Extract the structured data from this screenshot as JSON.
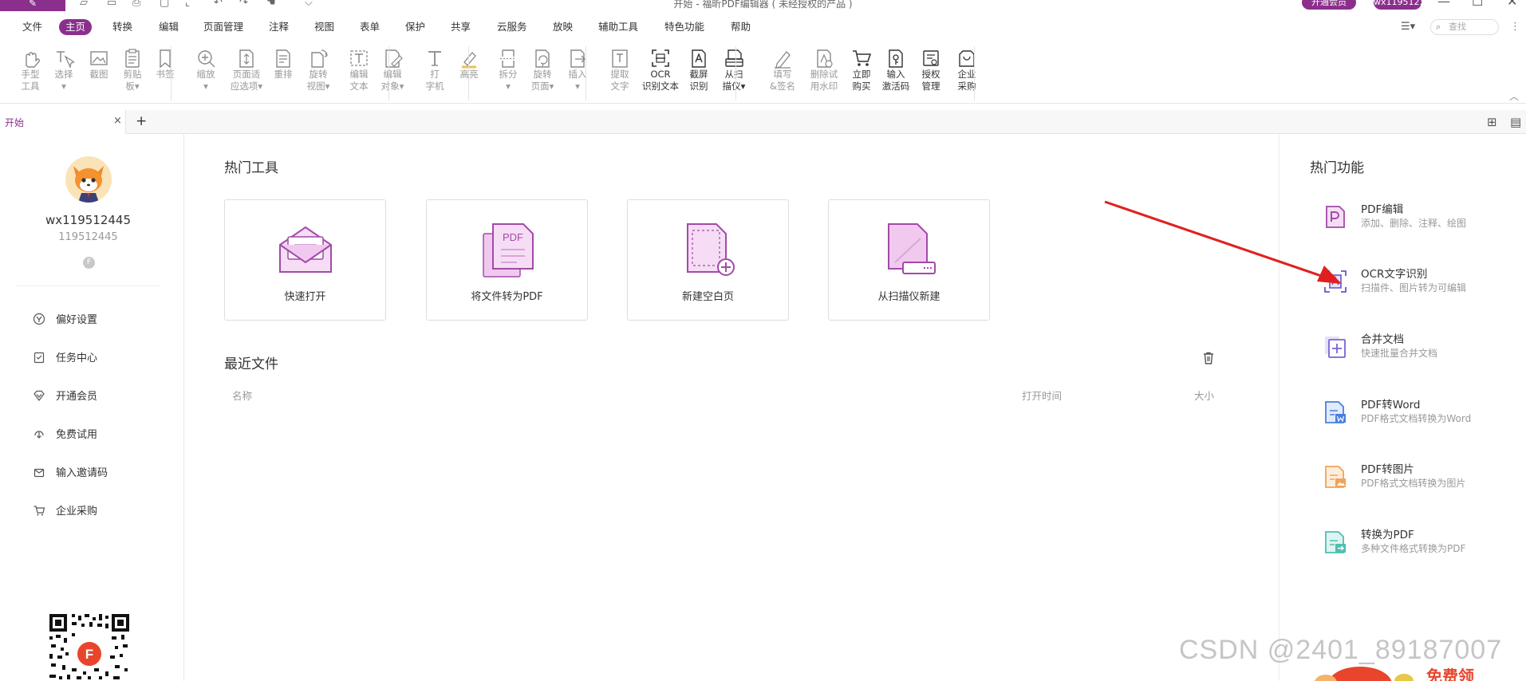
{
  "titlebar": {
    "title": "开始 - 福昕PDF编辑器 ( 未经授权的产品 )",
    "vip_button": "开通会员",
    "user": "wx119512...",
    "minimize": "—",
    "maximize": "☐",
    "close": "✕"
  },
  "menu": {
    "items": [
      "文件",
      "主页",
      "转换",
      "编辑",
      "页面管理",
      "注释",
      "视图",
      "表单",
      "保护",
      "共享",
      "云服务",
      "放映",
      "辅助工具",
      "特色功能",
      "帮助"
    ],
    "active_index": 1,
    "search_placeholder": "查找"
  },
  "ribbon": {
    "tools": [
      {
        "label": "手型\n工具",
        "icon": "hand-icon",
        "disabled": true
      },
      {
        "label": "选择\n▾",
        "icon": "select-text-icon",
        "disabled": true
      },
      {
        "label": "截图",
        "icon": "snapshot-icon",
        "disabled": true
      },
      {
        "label": "剪贴\n板▾",
        "icon": "clipboard-icon",
        "disabled": true
      },
      {
        "label": "书签",
        "icon": "bookmark-icon",
        "disabled": true
      },
      {
        "label": "缩放\n▾",
        "icon": "zoom-icon",
        "disabled": true
      },
      {
        "label": "页面适\n应选项▾",
        "icon": "fit-page-icon",
        "disabled": true
      },
      {
        "label": "重排",
        "icon": "reflow-icon",
        "disabled": true
      },
      {
        "label": "旋转\n视图▾",
        "icon": "rotate-view-icon",
        "disabled": true
      },
      {
        "label": "编辑\n文本",
        "icon": "edit-text-icon",
        "disabled": true
      },
      {
        "label": "编辑\n对象▾",
        "icon": "edit-object-icon",
        "disabled": true
      },
      {
        "label": "打\n字机",
        "icon": "typewriter-icon",
        "disabled": true
      },
      {
        "label": "高亮",
        "icon": "highlight-icon",
        "disabled": true
      },
      {
        "label": "拆分\n▾",
        "icon": "split-icon",
        "disabled": true
      },
      {
        "label": "旋转\n页面▾",
        "icon": "rotate-page-icon",
        "disabled": true
      },
      {
        "label": "插入\n▾",
        "icon": "insert-icon",
        "disabled": true
      },
      {
        "label": "提取\n文字",
        "icon": "extract-text-icon",
        "disabled": true
      },
      {
        "label": "OCR\n识别文本",
        "icon": "ocr-icon",
        "disabled": false
      },
      {
        "label": "截屏\n识别",
        "icon": "screenshot-ocr-icon",
        "disabled": false
      },
      {
        "label": "从扫\n描仪▾",
        "icon": "scanner-icon",
        "disabled": false
      },
      {
        "label": "填写\n&签名",
        "icon": "fill-sign-icon",
        "disabled": true
      },
      {
        "label": "删除试\n用水印",
        "icon": "remove-watermark-icon",
        "disabled": true
      },
      {
        "label": "立即\n购买",
        "icon": "cart-icon",
        "disabled": false
      },
      {
        "label": "输入\n激活码",
        "icon": "activation-icon",
        "disabled": false
      },
      {
        "label": "授权\n管理",
        "icon": "license-icon",
        "disabled": false
      },
      {
        "label": "企业\n采购",
        "icon": "enterprise-icon",
        "disabled": false
      }
    ]
  },
  "tabs": {
    "current": "开始",
    "close": "×",
    "add": "+"
  },
  "sidebar": {
    "username": "wx119512445",
    "user_id": "119512445",
    "badge": "F",
    "nav": [
      {
        "label": "偏好设置",
        "icon": "preferences-icon"
      },
      {
        "label": "任务中心",
        "icon": "task-center-icon"
      },
      {
        "label": "开通会员",
        "icon": "membership-icon"
      },
      {
        "label": "免费试用",
        "icon": "free-trial-icon"
      },
      {
        "label": "输入邀请码",
        "icon": "invite-code-icon"
      },
      {
        "label": "企业采购",
        "icon": "enterprise-purchase-icon"
      }
    ]
  },
  "main": {
    "hot_tools_title": "热门工具",
    "hot_tools": [
      {
        "label": "快速打开",
        "icon": "quick-open-icon"
      },
      {
        "label": "将文件转为PDF",
        "icon": "convert-to-pdf-icon"
      },
      {
        "label": "新建空白页",
        "icon": "new-blank-page-icon"
      },
      {
        "label": "从扫描仪新建",
        "icon": "new-from-scanner-icon"
      }
    ],
    "pdf_badge": "PDF",
    "recent_title": "最近文件",
    "columns": {
      "name": "名称",
      "open_time": "打开时间",
      "size": "大小"
    }
  },
  "right_panel": {
    "title": "热门功能",
    "features": [
      {
        "title": "PDF编辑",
        "subtitle": "添加、删除、注释、绘图",
        "color": "#a24aa8",
        "icon": "pdf-edit-icon"
      },
      {
        "title": "OCR文字识别",
        "subtitle": "扫描件、图片转为可编辑",
        "color": "#6b55c8",
        "icon": "ocr-recognize-icon"
      },
      {
        "title": "合并文档",
        "subtitle": "快速批量合并文档",
        "color": "#7b63d6",
        "icon": "merge-docs-icon"
      },
      {
        "title": "PDF转Word",
        "subtitle": "PDF格式文档转换为Word",
        "color": "#4a7fe0",
        "icon": "pdf-to-word-icon"
      },
      {
        "title": "PDF转图片",
        "subtitle": "PDF格式文档转换为图片",
        "color": "#f0a25a",
        "icon": "pdf-to-image-icon"
      },
      {
        "title": "转换为PDF",
        "subtitle": "多种文件格式转换为PDF",
        "color": "#4fbfb0",
        "icon": "convert-pdf-icon"
      }
    ]
  },
  "overlay": {
    "watermark": "CSDN @2401_89187007",
    "promo": "免费领",
    "arrow_color": "#e02020"
  }
}
